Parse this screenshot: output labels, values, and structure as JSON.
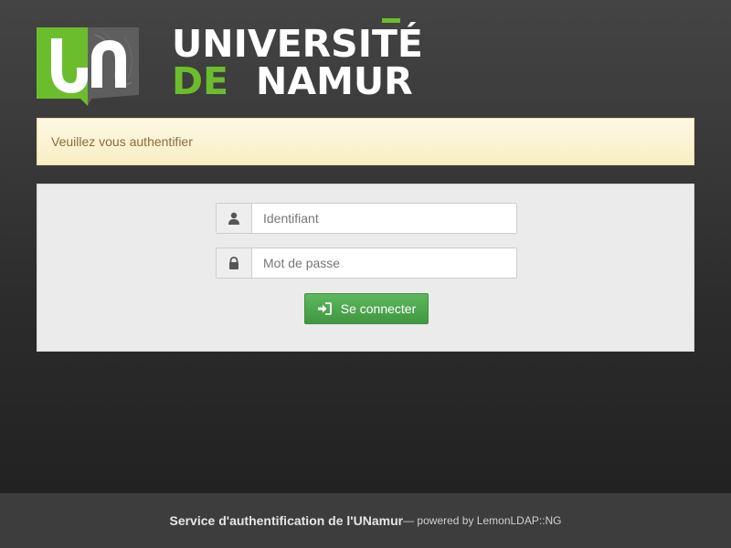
{
  "header": {
    "logo_icon": "unamur-un-logo-icon",
    "wordmark_line1": "UNIVERSITÉ",
    "wordmark_de": "DE",
    "wordmark_namur": "NAMUR",
    "brand_green": "#6cbd2d"
  },
  "alert": {
    "message": "Veuillez vous authentifier",
    "text_color": "#8a6d3b",
    "background": "#fcf8e3"
  },
  "login_form": {
    "username": {
      "icon": "user-icon",
      "placeholder": "Identifiant",
      "value": ""
    },
    "password": {
      "icon": "lock-icon",
      "placeholder": "Mot de passe",
      "value": ""
    },
    "submit": {
      "icon": "sign-in-icon",
      "label": "Se connecter",
      "color": "#5cb85c"
    }
  },
  "footer": {
    "service": "Service d'authentification de l'UNamur",
    "powered_by": "— powered by LemonLDAP::NG"
  }
}
